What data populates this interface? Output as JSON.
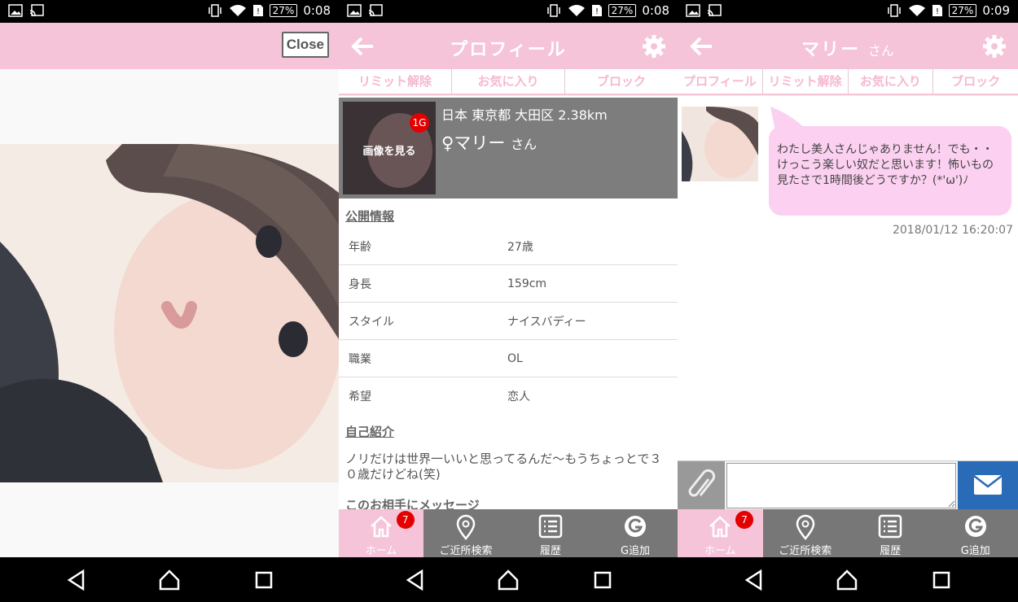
{
  "status_bars": [
    {
      "time": "0:08",
      "battery": "27%"
    },
    {
      "time": "0:08",
      "battery": "27%"
    },
    {
      "time": "0:09",
      "battery": "27%"
    }
  ],
  "screen1": {
    "close_label": "Close"
  },
  "screen2": {
    "title": "プロフィール",
    "tabs": [
      "リミット解除",
      "お気に入り",
      "ブロック"
    ],
    "card": {
      "thumb_label": "画像を見る",
      "badge": "1G",
      "location": "日本 東京都 大田区 2.38km",
      "name": "♀マリー",
      "name_suffix": "さん"
    },
    "public_info_title": "公開情報",
    "info_rows": [
      {
        "key": "年齢",
        "value": "27歳"
      },
      {
        "key": "身長",
        "value": "159cm"
      },
      {
        "key": "スタイル",
        "value": "ナイスバディー"
      },
      {
        "key": "職業",
        "value": "OL"
      },
      {
        "key": "希望",
        "value": "恋人"
      }
    ],
    "intro_title": "自己紹介",
    "intro_text": "ノリだけは世界一いいと思ってるんだ〜もうちょっとで３０歳だけどね(笑)",
    "message_title": "このお相手にメッセージ"
  },
  "screen3": {
    "title": "マリー",
    "title_suffix": "さん",
    "tabs": [
      "プロフィール",
      "リミット解除",
      "お気に入り",
      "ブロック"
    ],
    "message": "わたし美人さんじゃありません！でも・・けっこう楽しい奴だと思います！怖いもの見たさで1時間後どうですか？(*'ω')ﾉ",
    "timestamp": "2018/01/12 16:20:07",
    "input_value": ""
  },
  "bottom_nav": {
    "items": [
      "ホーム",
      "ご近所検索",
      "履歴",
      "G追加"
    ],
    "home_badge": "7"
  },
  "colors": {
    "header_pink": "#f5c4d8",
    "bubble_pink": "#fbd0f0",
    "card_gray": "#7d7d7d",
    "send_blue": "#2a6bb8"
  }
}
